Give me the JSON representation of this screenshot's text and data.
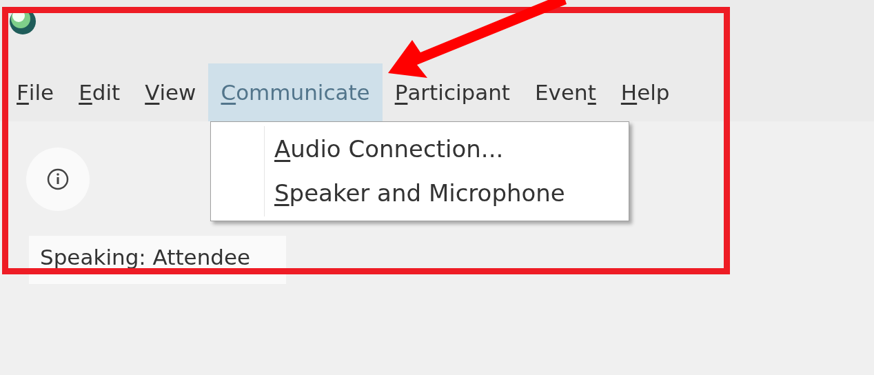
{
  "menu_bar": [
    {
      "parts": [
        {
          "text": "F",
          "underlined": true
        },
        {
          "text": "ile",
          "underlined": false
        }
      ],
      "selected": false
    },
    {
      "parts": [
        {
          "text": "E",
          "underlined": true
        },
        {
          "text": "dit",
          "underlined": false
        }
      ],
      "selected": false
    },
    {
      "parts": [
        {
          "text": "V",
          "underlined": true
        },
        {
          "text": "iew",
          "underlined": false
        }
      ],
      "selected": false
    },
    {
      "parts": [
        {
          "text": "C",
          "underlined": true
        },
        {
          "text": "ommunicate",
          "underlined": false
        }
      ],
      "selected": true
    },
    {
      "parts": [
        {
          "text": "P",
          "underlined": true
        },
        {
          "text": "articipant",
          "underlined": false
        }
      ],
      "selected": false
    },
    {
      "parts": [
        {
          "text": "Even",
          "underlined": false
        },
        {
          "text": "t",
          "underlined": true
        }
      ],
      "selected": false
    },
    {
      "parts": [
        {
          "text": "H",
          "underlined": true
        },
        {
          "text": "elp",
          "underlined": false
        }
      ],
      "selected": false
    }
  ],
  "dropdown": [
    {
      "parts": [
        {
          "text": "A",
          "underlined": true
        },
        {
          "text": "udio Connection...",
          "underlined": false
        }
      ]
    },
    {
      "parts": [
        {
          "text": "S",
          "underlined": true
        },
        {
          "text": "peaker and Microphone",
          "underlined": false
        }
      ]
    }
  ],
  "speaking_label": "Speaking: Attendee"
}
